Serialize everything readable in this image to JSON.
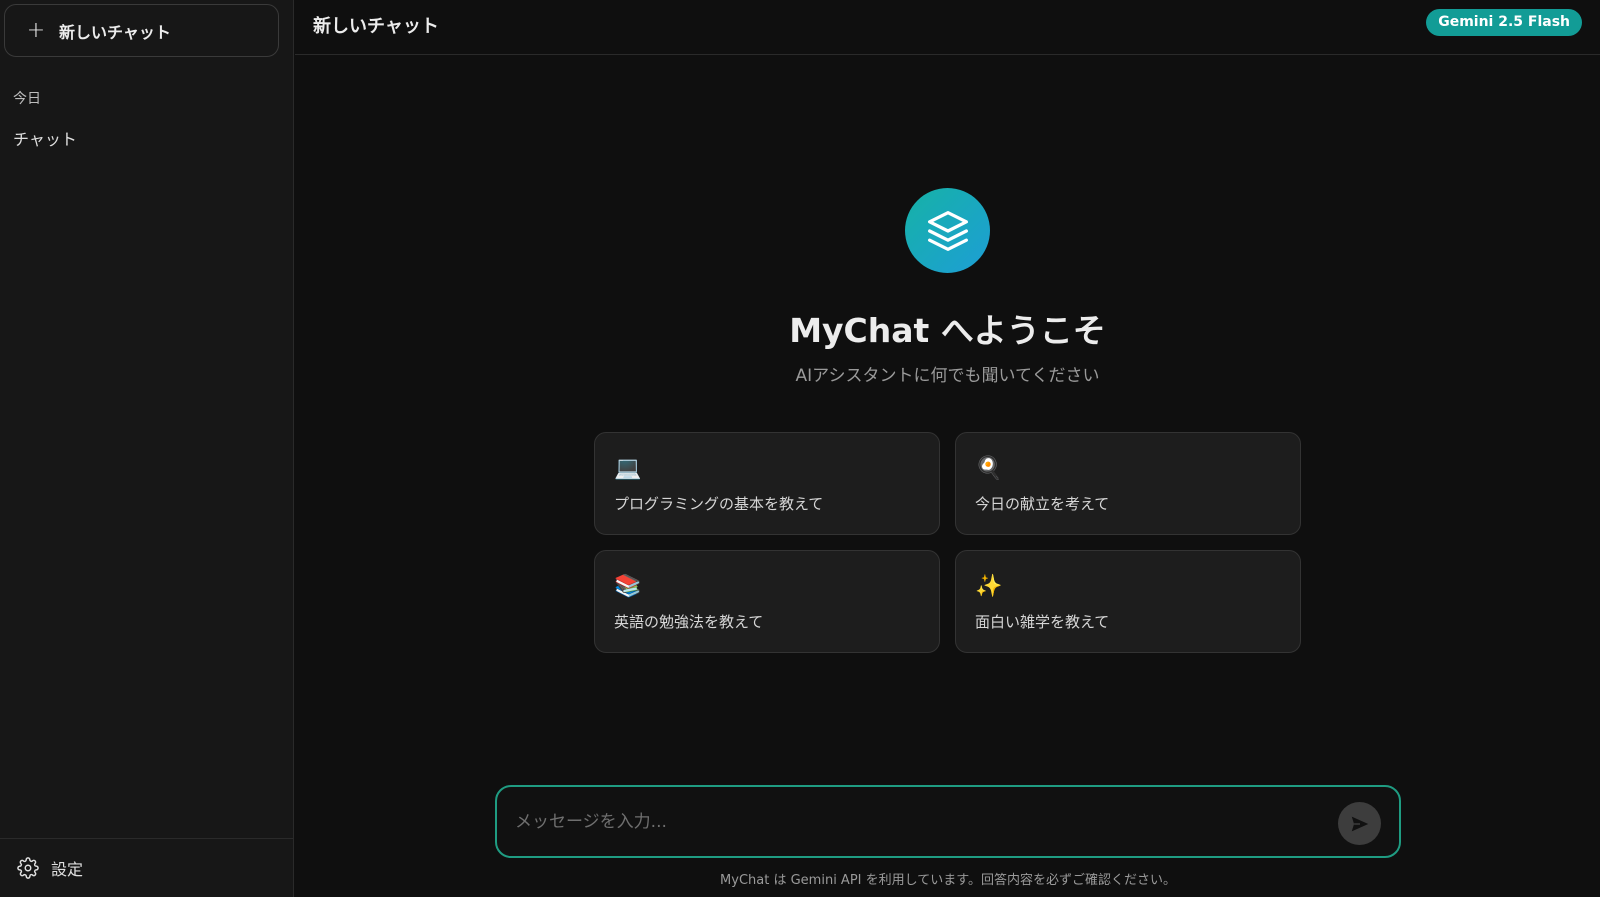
{
  "sidebar": {
    "new_chat_label": "新しいチャット",
    "section_today": "今日",
    "history": [
      {
        "label": "チャット"
      }
    ],
    "settings_label": "設定"
  },
  "header": {
    "title": "新しいチャット",
    "model_badge": "Gemini 2.5 Flash"
  },
  "welcome": {
    "title": "MyChat へようこそ",
    "subtitle": "AIアシスタントに何でも聞いてください",
    "suggestions": [
      {
        "emoji": "💻",
        "label": "プログラミングの基本を教えて"
      },
      {
        "emoji": "🍳",
        "label": "今日の献立を考えて"
      },
      {
        "emoji": "📚",
        "label": "英語の勉強法を教えて"
      },
      {
        "emoji": "✨",
        "label": "面白い雑学を教えて"
      }
    ]
  },
  "composer": {
    "placeholder": "メッセージを入力...",
    "value": "",
    "disclaimer": "MyChat は Gemini API を利用しています。回答内容を必ずご確認ください。"
  },
  "icons": {
    "new_chat": "plus-icon",
    "settings": "gear-icon",
    "logo": "layers-icon",
    "send": "send-icon"
  },
  "colors": {
    "accent": "#129c96",
    "input_border": "#1f9c82",
    "background": "#0f0f0f",
    "sidebar": "#171717"
  }
}
